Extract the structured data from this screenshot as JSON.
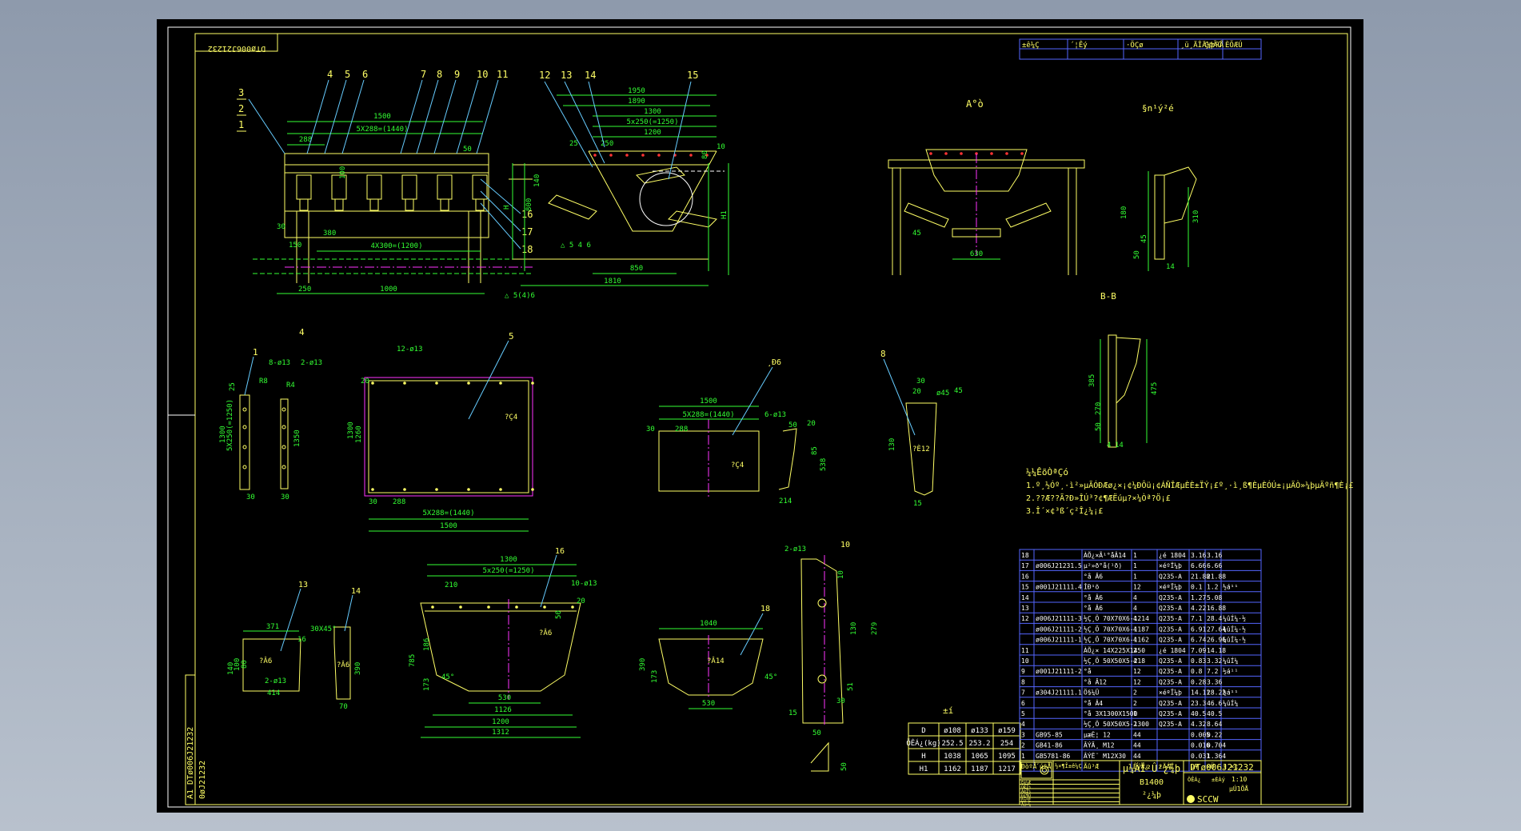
{
  "colors": {
    "background": "#000000",
    "frame": "#ffffff",
    "outline": "#ffff66",
    "dimension": "#33ff33",
    "leader": "#66ccff",
    "centerline": "#ff33ff",
    "table": "#5566ff"
  },
  "drawing": {
    "number": "DTø006J21232",
    "number_mirrored": "DTø006J21232",
    "side_code": "A1 DTø006J21232",
    "side_code2": "0øJ21232"
  },
  "main_view": {
    "balloons_top": [
      "4",
      "5",
      "6",
      "7",
      "8",
      "9",
      "10",
      "11",
      "12",
      "13",
      "14",
      "15"
    ],
    "balloons_left": [
      "3",
      "2",
      "1"
    ],
    "balloons_right": [
      "16",
      "17",
      "18"
    ],
    "dims": [
      "1500",
      "5X288=(1440)",
      "288",
      "50",
      "30",
      "150",
      "380",
      "4X300=(1200)",
      "250",
      "1000",
      "100"
    ],
    "weld": "△ 5(4)6"
  },
  "section_view": {
    "dims": [
      "1950",
      "1890",
      "1300",
      "5x250(=1250)",
      "1200",
      "250",
      "140",
      "800",
      "H",
      "H1",
      "80",
      "25",
      "850",
      "1810",
      "10"
    ],
    "weld": "△ 5 4 6"
  },
  "view_a": {
    "label": "A°ò",
    "dims": [
      "45",
      "630"
    ]
  },
  "detail_topright": {
    "label": "§n¹ý²é",
    "dims": [
      "180",
      "50",
      "45",
      "14",
      "310"
    ]
  },
  "section_bb": {
    "label": "B-B",
    "dims": [
      "385",
      "270",
      "50",
      "14",
      "475",
      "4"
    ]
  },
  "part1": {
    "balloon": "1",
    "dims": [
      "8-ø13",
      "25",
      "1300",
      "5X250(=1250)",
      "30",
      "R8"
    ]
  },
  "part4": {
    "balloon": "4",
    "dims": [
      "2-ø13",
      "1350",
      "R4",
      "30"
    ]
  },
  "part5": {
    "balloon": "5",
    "dims": [
      "12-ø13",
      "20",
      "1300",
      "1260",
      "30",
      "288",
      "5X288=(1440)",
      "1500"
    ],
    "mark": "?Ç4"
  },
  "part_mid": {
    "balloon": "¸Ð6",
    "dims": [
      "1500",
      "5X288=(1440)",
      "288",
      "30",
      "6-ø13",
      "50",
      "20",
      "85",
      "538",
      "214"
    ],
    "mark": "?Ç4"
  },
  "part8": {
    "balloon": "8",
    "dims": [
      "30",
      "20",
      "ø45",
      "130",
      "15",
      "45"
    ],
    "mark": "?È12"
  },
  "part13": {
    "balloon": "13",
    "dims": [
      "371",
      "140",
      "100",
      "80",
      "2-ø13",
      "414",
      "16"
    ],
    "mark": "?Â6"
  },
  "part14": {
    "balloon": "14",
    "dims": [
      "30X45°",
      "390",
      "70"
    ],
    "mark": "?Â6"
  },
  "part16": {
    "balloon": "16",
    "dims": [
      "1300",
      "5x250(=1250)",
      "210",
      "10-ø13",
      "20",
      "50",
      "186",
      "785",
      "530",
      "1126",
      "1200",
      "1312",
      "173",
      "45°"
    ],
    "mark": "?Â6"
  },
  "part18": {
    "balloon": "18",
    "dims": [
      "1040",
      "390",
      "173",
      "530",
      "45°"
    ],
    "mark": "?Â14"
  },
  "part10": {
    "balloon": "10",
    "dims": [
      "2-ø13",
      "10",
      "130",
      "279",
      "51",
      "30",
      "15",
      "50"
    ]
  },
  "notes": {
    "title": "¼¼ÊõÒªÇó",
    "lines": [
      "1.º¸½Óº¸·ì²»µÃÓÐÆø¿×¡¢¼ÐÔü¡¢ÁÑÎÆµÈÈ±ÏÝ¡£º¸·ì¸ß¶ÈµÈÓÚ±¡µÄÒ»¼þµÄºñ¶È¡£",
      "2.??Æ??Ã?Ð»ÎÚ³?¢¶ÆËúµ?×¼Òª?Ö¡£",
      "3.Î´×¢³ß´ç²Î¿¼¡£"
    ]
  },
  "dim_table": {
    "title": "±í",
    "headers": [
      "D",
      "ø108",
      "ø133",
      "ø159"
    ],
    "rows": [
      [
        "ÖÊÁ¿(kg)",
        "252.5",
        "253.2",
        "254"
      ],
      [
        "H",
        "1038",
        "1065",
        "1095"
      ],
      [
        "H1",
        "1162",
        "1187",
        "1217"
      ]
    ]
  },
  "revision_header": [
    "±ê¼Ç",
    "´¦Êý",
    "·ÖÇø",
    "¸ü¸ÄÎÄ¼þºÅ",
    "Ç©Ãû",
    "ÈÕÆÚ"
  ],
  "bom": [
    {
      "no": "18",
      "code": "",
      "name": "ÀÕ¿×Ã¹°åÂ14",
      "qty": "1",
      "material": "¿é 1804",
      "w1": "3.16",
      "w2": "3.16",
      "note": ""
    },
    {
      "no": "17",
      "code": "ø006J21231.5",
      "name": "µ²»ð°å(¹ð)",
      "qty": "1",
      "material": "×éºÏ¼þ",
      "w1": "6.66",
      "w2": "6.66",
      "note": ""
    },
    {
      "no": "16",
      "code": "",
      "name": "°å  Â6",
      "qty": "1",
      "material": "Q235-A",
      "w1": "21.88",
      "w2": "21.88",
      "note": ""
    },
    {
      "no": "15",
      "code": "ø001J21111.4",
      "name": "ÍÐ¹õ",
      "qty": "12",
      "material": "×éºÏ¼þ",
      "w1": "0.1",
      "w2": "1.2",
      "note": "½á¹¹"
    },
    {
      "no": "14",
      "code": "",
      "name": "°å  Â6",
      "qty": "4",
      "material": "Q235-A",
      "w1": "1.27",
      "w2": "5.08",
      "note": ""
    },
    {
      "no": "13",
      "code": "",
      "name": "°å  Â6",
      "qty": "4",
      "material": "Q235-A",
      "w1": "4.22",
      "w2": "16.88",
      "note": ""
    },
    {
      "no": "12",
      "code": "ø006J21111-3",
      "name": "½Ç¸Ö 70X70X6-1214",
      "qty": "4",
      "material": "Q235-A",
      "w1": "7.1",
      "w2": "28.4",
      "note": "¼ûÍ¼·½"
    },
    {
      "no": "",
      "code": "ø006J21111-2",
      "name": "½Ç¸Ö 70X70X6-1187",
      "qty": "4",
      "material": "Q235-A",
      "w1": "6.91",
      "w2": "27.64",
      "note": "¼ûÍ¼·½"
    },
    {
      "no": "",
      "code": "ø006J21111-1",
      "name": "½Ç¸Ö 70X70X6-1162",
      "qty": "4",
      "material": "Q235-A",
      "w1": "6.74",
      "w2": "26.96",
      "note": "¼ûÍ¼·½"
    },
    {
      "no": "11",
      "code": "",
      "name": "ÀÕ¿× 14X225X1450",
      "qty": "2",
      "material": "¿é 1804",
      "w1": "7.09",
      "w2": "14.18",
      "note": ""
    },
    {
      "no": "10",
      "code": "",
      "name": "½Ç¸Ö 50X50X5-218",
      "qty": "4",
      "material": "Q235-A",
      "w1": "0.83",
      "w2": "3.32",
      "note": "¼ûÍ¼"
    },
    {
      "no": "9",
      "code": "ø001J21111-2",
      "name": "°å",
      "qty": "12",
      "material": "Q235-A",
      "w1": "0.8",
      "w2": "7.2",
      "note": "½á¹¹"
    },
    {
      "no": "8",
      "code": "",
      "name": "°å  Â12",
      "qty": "12",
      "material": "Q235-A",
      "w1": "0.28",
      "w2": "3.36",
      "note": ""
    },
    {
      "no": "7",
      "code": "ø304J21111.1",
      "name": "Ö§¼Ü",
      "qty": "2",
      "material": "×éºÏ¼þ",
      "w1": "14.11",
      "w2": "28.22",
      "note": "½á¹¹"
    },
    {
      "no": "6",
      "code": "",
      "name": "°å  Â4",
      "qty": "2",
      "material": "Q235-A",
      "w1": "23.3",
      "w2": "46.6",
      "note": "¼ûÍ¼"
    },
    {
      "no": "5",
      "code": "",
      "name": "°å 3X1300X1500",
      "qty": "1",
      "material": "Q235-A",
      "w1": "40.5",
      "w2": "40.5",
      "note": ""
    },
    {
      "no": "4",
      "code": "",
      "name": "½Ç¸Ö 50X50X5-1300",
      "qty": "2",
      "material": "Q235-A",
      "w1": "4.32",
      "w2": "8.64",
      "note": ""
    },
    {
      "no": "3",
      "code": "GB95-85",
      "name": "µæÈ¦ 12",
      "qty": "44",
      "material": "",
      "w1": "0.005",
      "w2": "0.22",
      "note": ""
    },
    {
      "no": "2",
      "code": "GB41-86",
      "name": "ÂÝÄ¸ M12",
      "qty": "44",
      "material": "",
      "w1": "0.016",
      "w2": "0.704",
      "note": ""
    },
    {
      "no": "1",
      "code": "GB5781-86",
      "name": "ÂÝË¨ M12X30",
      "qty": "44",
      "material": "",
      "w1": "0.031",
      "w2": "1.364",
      "note": ""
    }
  ],
  "bom_header": [
    "ÐòºÅ",
    "´úºÅ",
    "Ãû³Æ",
    "ÊýÁ¿",
    "²ÄÁÏ",
    "µ¥",
    "×Ü",
    "±¸×¢"
  ],
  "title_block": {
    "product": "µ¼ÁÏ²Û²¿¼þ",
    "spec": "B1400",
    "type": "²¿¼þ",
    "number": "DTø006J21232",
    "company": "SCCW",
    "scale": "1:10",
    "sheet": "µÚ1ÕÅ",
    "cells_left": [
      "Éè¼Æ",
      "ÖÆÍ¼",
      "ÃèÍ¼",
      "Ð£¶Ô",
      "ÉóºË",
      "Åú×¼"
    ],
    "cells_stage": "½×¶Î±ê¼Ç",
    "weight_label": "ÖÊÁ¿",
    "scale_label": "±ÈÀý"
  }
}
